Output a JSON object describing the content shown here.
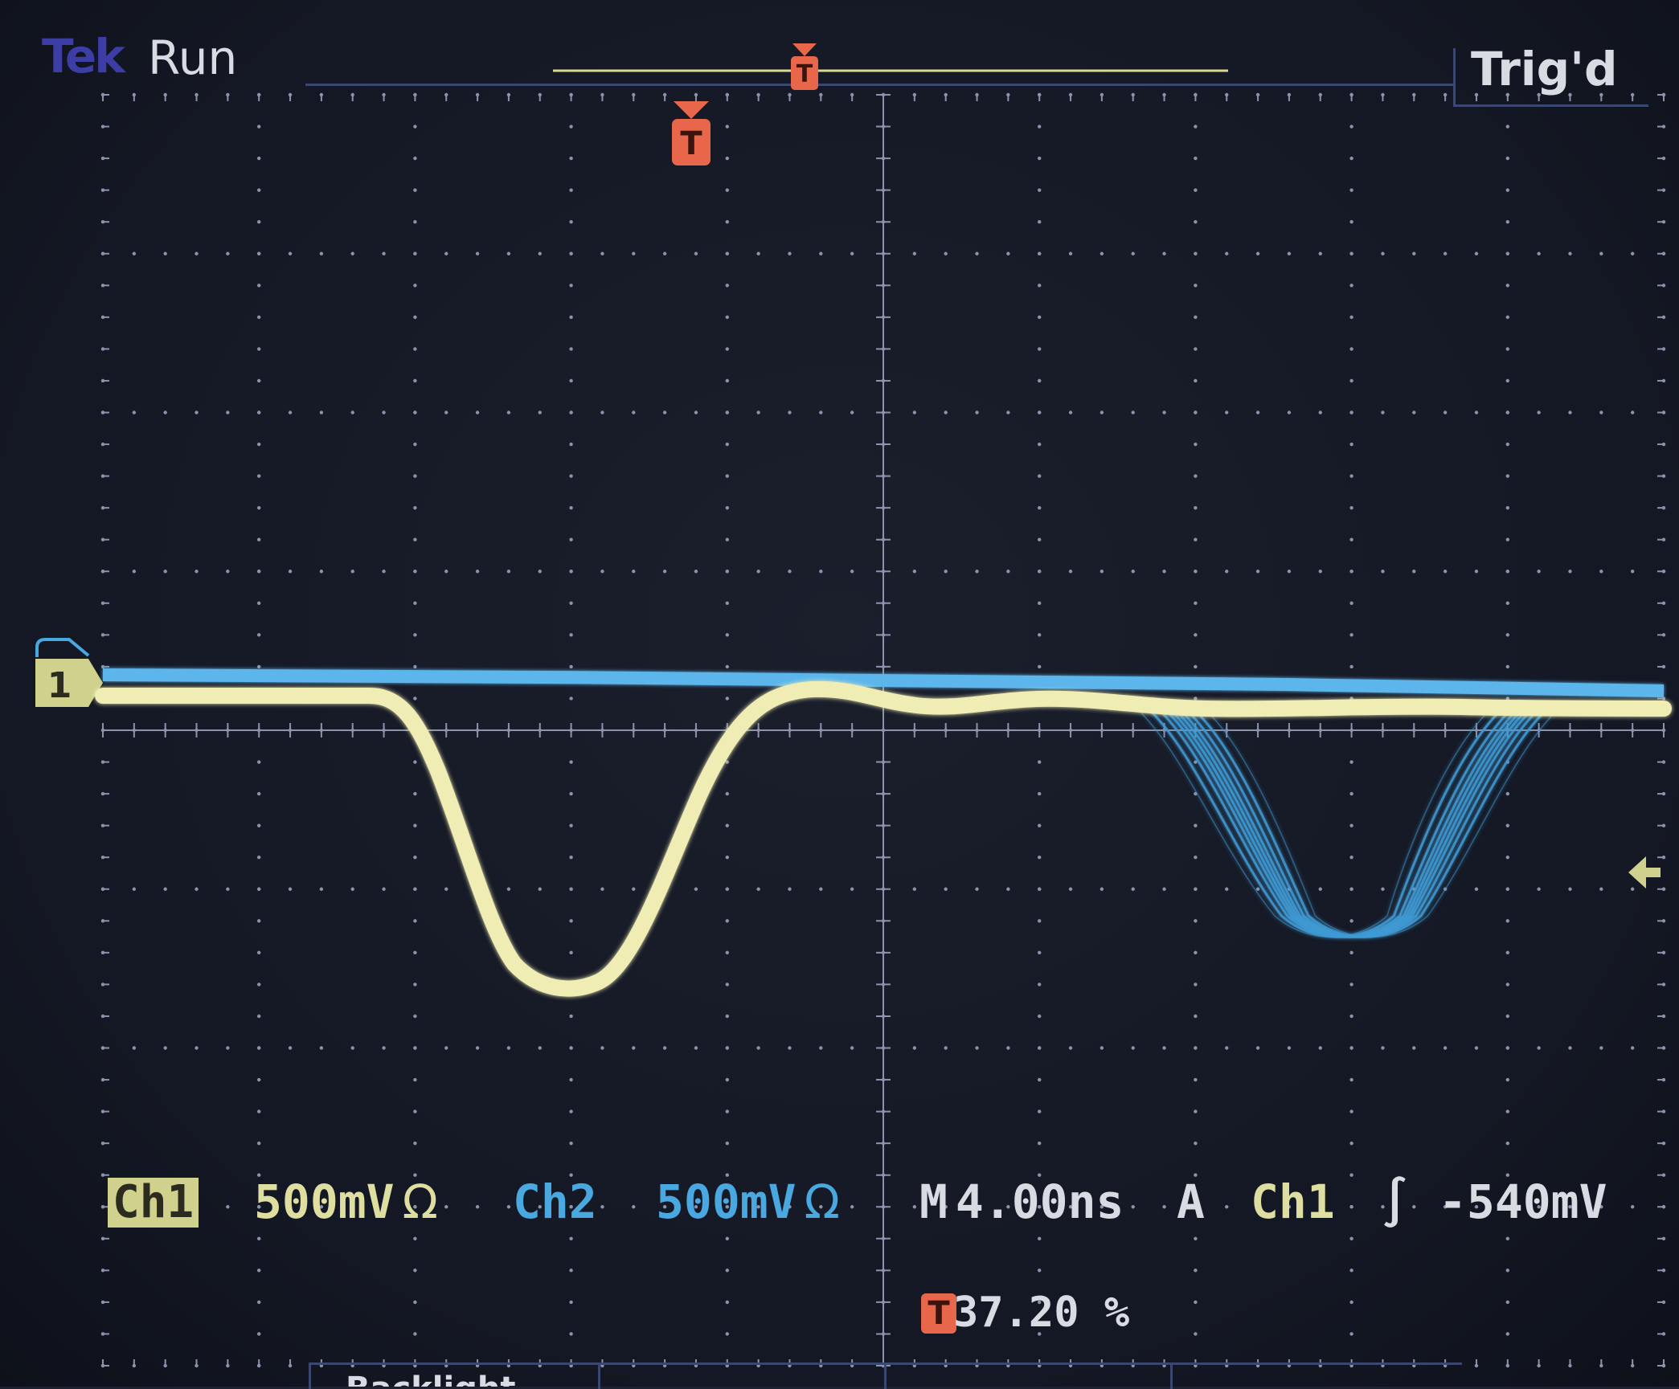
{
  "header": {
    "brand": "Tek",
    "acquisition_state": "Run",
    "trigger_status": "Trig'd"
  },
  "channel1": {
    "tag": "Ch1",
    "scale": "500mV",
    "coupling_symbol": "Ω",
    "ground_marker": "1",
    "color": "#e8e6a8"
  },
  "channel2": {
    "tag": "Ch2",
    "scale": "500mV",
    "coupling_symbol": "Ω",
    "color": "#4aa8e0"
  },
  "timebase": {
    "label": "M",
    "value": "4.00ns"
  },
  "trigger": {
    "mode": "A",
    "source": "Ch1",
    "slope_symbol": "∫",
    "level": "-540mV",
    "marker_label": "T",
    "position_percent": "37.20 %"
  },
  "menu": {
    "partial_label": "Backlight"
  },
  "colors": {
    "graticule": "#8c93ad",
    "trigger_marker": "#e8664a",
    "background": "#141824"
  },
  "icons": {
    "trigger_marker": "red-T-flag-icon",
    "ground_marker": "channel-1-ground-arrow-icon",
    "trigger_level": "left-arrow-icon"
  }
}
